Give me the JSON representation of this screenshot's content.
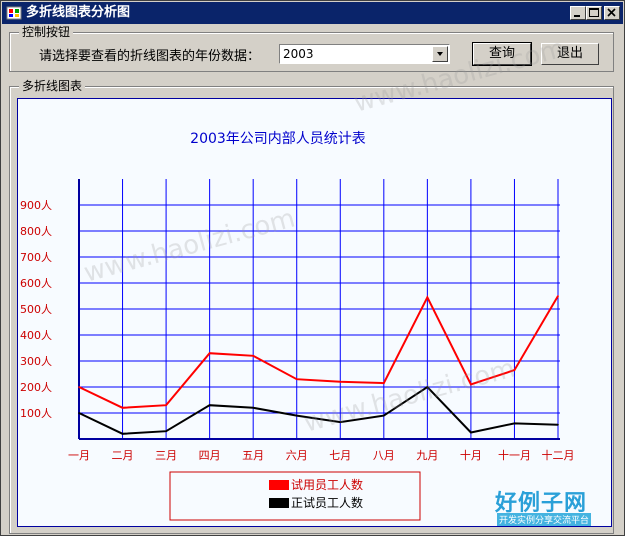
{
  "window": {
    "title": "多折线图表分析图"
  },
  "controls": {
    "group_title": "控制按钮",
    "prompt": "请选择要查看的折线图表的年份数据：",
    "year_value": "2003",
    "query_label": "查询",
    "exit_label": "退出"
  },
  "chart_group": {
    "title": "多折线图表"
  },
  "watermark": {
    "text": "www.haolizi.com"
  },
  "logo": {
    "main": "好例子网",
    "sub": "开发实例分享交流平台"
  },
  "colors": {
    "title_bar": "#0a246a",
    "grid": "#0000ff",
    "axis_label": "#cc0000",
    "series_trial": "#ff0000",
    "series_regular": "#000000",
    "title_text": "#0000cc"
  },
  "chart_data": {
    "type": "line",
    "title": "2003年公司内部人员统计表",
    "categories": [
      "一月",
      "二月",
      "三月",
      "四月",
      "五月",
      "六月",
      "七月",
      "八月",
      "九月",
      "十月",
      "十一月",
      "十二月"
    ],
    "y_ticks": [
      "100人",
      "200人",
      "300人",
      "400人",
      "500人",
      "600人",
      "700人",
      "800人",
      "900人"
    ],
    "ylim": [
      0,
      1000
    ],
    "series": [
      {
        "name": "试用员工人数",
        "color": "#ff0000",
        "values": [
          200,
          120,
          130,
          330,
          320,
          230,
          220,
          215,
          545,
          210,
          265,
          550
        ]
      },
      {
        "name": "正试员工人数",
        "color": "#000000",
        "values": [
          100,
          20,
          30,
          130,
          120,
          90,
          65,
          90,
          200,
          25,
          60,
          55
        ]
      }
    ],
    "legend_position": "bottom-center",
    "grid": true
  }
}
